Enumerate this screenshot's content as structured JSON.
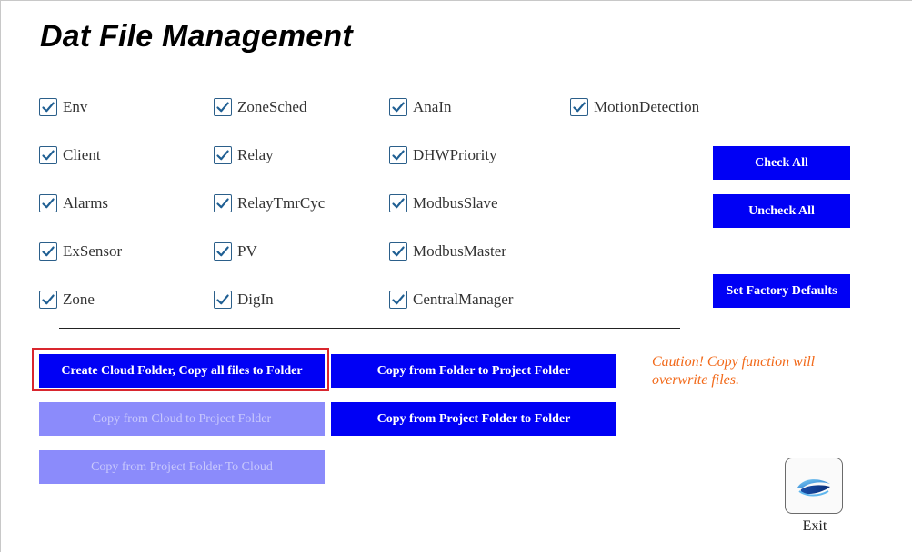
{
  "title": "Dat File Management",
  "checkboxes": [
    {
      "label": "Env",
      "checked": true
    },
    {
      "label": "ZoneSched",
      "checked": true
    },
    {
      "label": "AnaIn",
      "checked": true
    },
    {
      "label": "MotionDetection",
      "checked": true
    },
    {
      "label": "Client",
      "checked": true
    },
    {
      "label": "Relay",
      "checked": true
    },
    {
      "label": "DHWPriority",
      "checked": true
    },
    {
      "label": "Alarms",
      "checked": true
    },
    {
      "label": "RelayTmrCyc",
      "checked": true
    },
    {
      "label": "ModbusSlave",
      "checked": true
    },
    {
      "label": "ExSensor",
      "checked": true
    },
    {
      "label": "PV",
      "checked": true
    },
    {
      "label": "ModbusMaster",
      "checked": true
    },
    {
      "label": "Zone",
      "checked": true
    },
    {
      "label": "DigIn",
      "checked": true
    },
    {
      "label": "CentralManager",
      "checked": true
    }
  ],
  "side_buttons": {
    "check_all": "Check All",
    "uncheck_all": "Uncheck All",
    "factory_defaults": "Set Factory Defaults"
  },
  "actions": {
    "create_cloud_folder": "Create Cloud Folder, Copy all files to Folder",
    "copy_folder_to_project": "Copy from Folder to Project Folder",
    "copy_cloud_to_project": "Copy from Cloud to Project Folder",
    "copy_project_to_folder": "Copy from Project Folder to Folder",
    "copy_project_to_cloud": "Copy from Project Folder To Cloud"
  },
  "caution_text": "Caution! Copy function will overwrite files.",
  "exit_label": "Exit",
  "colors": {
    "button_blue": "#0000f5",
    "button_disabled": "#8b8bfb",
    "caution_orange": "#f26a1b",
    "highlight_red": "#d9262e",
    "checkbox_border": "#2b5f8a"
  },
  "icons": {
    "checkbox_check": "checkmark-icon",
    "exit": "exit-swoosh-icon"
  }
}
